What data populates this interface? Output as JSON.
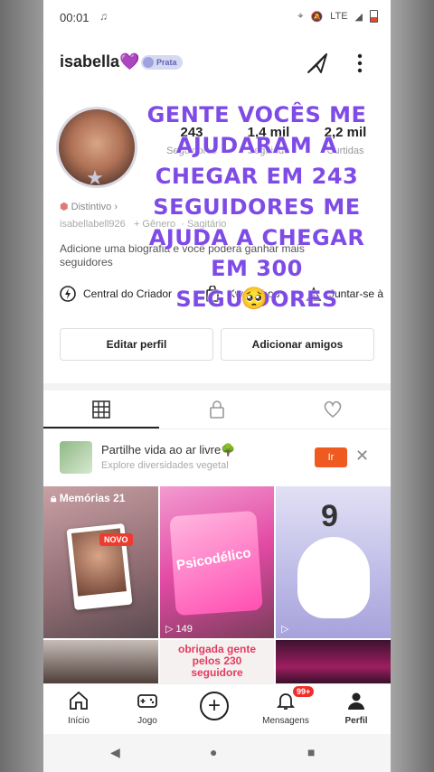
{
  "status": {
    "time": "00:01",
    "network": "LTE"
  },
  "profile": {
    "username": "isabella💜",
    "badge_label": "Prata",
    "handle": "isabellabell926",
    "gender": "+ Gênero",
    "sign": "Sagitário",
    "distintivo": "Distintivo ›",
    "bio": "Adicione uma biografia e você poderá ganhar mais seguidores"
  },
  "stats": [
    {
      "num": "243",
      "label": "Seguidores"
    },
    {
      "num": "1,4 mil",
      "label": "Seguindo"
    },
    {
      "num": "2,2 mil",
      "label": "Curtidas"
    }
  ],
  "quicklinks": [
    "Central do Criador",
    "Kwai Shop",
    "Juntar-se à"
  ],
  "buttons": {
    "edit": "Editar perfil",
    "add": "Adicionar amigos"
  },
  "overlay_text": "GENTE VOCÊS ME AJUDARAM A CHEGAR EM 243 SEGUIDORES ME AJUDA A CHEGAR EM 300 SEGUIDORES",
  "overlay_emoji": "🥺",
  "promo": {
    "title": "Partilhe vida ao ar livre🌳",
    "subtitle": "Explore diversidades vegetal",
    "go": "Ir",
    "close": "✕"
  },
  "grid": {
    "memories": "Memórias 21",
    "novo": "NOVO",
    "psicodelico": "Psicodélico",
    "play_count": "149",
    "nine": "9",
    "thanks": "obrigada gente pelos 230 seguidore"
  },
  "nav": [
    {
      "label": "Início"
    },
    {
      "label": "Jogo"
    },
    {
      "label": ""
    },
    {
      "label": "Mensagens",
      "badge": "99+"
    },
    {
      "label": "Perfil"
    }
  ],
  "colors": {
    "overlay": "#7f4be6",
    "accent": "#ee5a1f"
  }
}
